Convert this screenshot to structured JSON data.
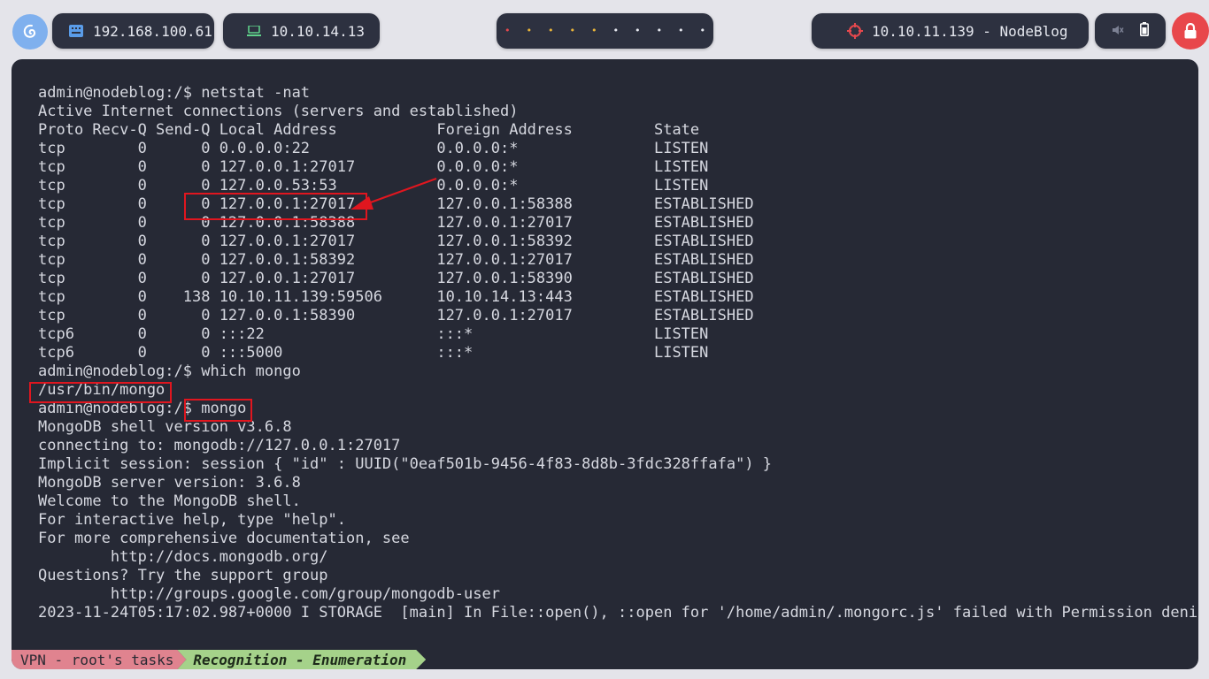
{
  "topbar": {
    "launcher_icon": "debian-swirl-icon",
    "local_ip": "192.168.100.61",
    "vpn_ip": "10.10.14.13",
    "workspaces": [
      {
        "color": "#e5484d"
      },
      {
        "color": "#e9b43a"
      },
      {
        "color": "#e9b43a"
      },
      {
        "color": "#e9b43a"
      },
      {
        "color": "#e9b43a"
      },
      {
        "color": "#e6e8ef"
      },
      {
        "color": "#e6e8ef"
      },
      {
        "color": "#e6e8ef"
      },
      {
        "color": "#e6e8ef"
      },
      {
        "color": "#e6e8ef"
      }
    ],
    "target": "10.10.11.139 - NodeBlog",
    "target_icon": "crosshair-target-icon",
    "mute_icon": "speaker-muted-icon",
    "battery_icon": "battery-icon",
    "lock_icon": "lock-icon"
  },
  "terminal": {
    "lines": [
      "admin@nodeblog:/$ netstat -nat",
      "Active Internet connections (servers and established)",
      "Proto Recv-Q Send-Q Local Address           Foreign Address         State",
      "tcp        0      0 0.0.0.0:22              0.0.0.0:*               LISTEN",
      "tcp        0      0 127.0.0.1:27017         0.0.0.0:*               LISTEN",
      "tcp        0      0 127.0.0.53:53           0.0.0.0:*               LISTEN",
      "tcp        0      0 127.0.0.1:27017         127.0.0.1:58388         ESTABLISHED",
      "tcp        0      0 127.0.0.1:58388         127.0.0.1:27017         ESTABLISHED",
      "tcp        0      0 127.0.0.1:27017         127.0.0.1:58392         ESTABLISHED",
      "tcp        0      0 127.0.0.1:58392         127.0.0.1:27017         ESTABLISHED",
      "tcp        0      0 127.0.0.1:27017         127.0.0.1:58390         ESTABLISHED",
      "tcp        0    138 10.10.11.139:59506      10.10.14.13:443         ESTABLISHED",
      "tcp        0      0 127.0.0.1:58390         127.0.0.1:27017         ESTABLISHED",
      "tcp6       0      0 :::22                   :::*                    LISTEN",
      "tcp6       0      0 :::5000                 :::*                    LISTEN",
      "admin@nodeblog:/$ which mongo",
      "/usr/bin/mongo",
      "admin@nodeblog:/$ mongo",
      "MongoDB shell version v3.6.8",
      "connecting to: mongodb://127.0.0.1:27017",
      "Implicit session: session { \"id\" : UUID(\"0eaf501b-9456-4f83-8d8b-3fdc328ffafa\") }",
      "MongoDB server version: 3.6.8",
      "Welcome to the MongoDB shell.",
      "For interactive help, type \"help\".",
      "For more comprehensive documentation, see",
      "        http://docs.mongodb.org/",
      "Questions? Try the support group",
      "        http://groups.google.com/group/mongodb-user",
      "2023-11-24T05:17:02.987+0000 I STORAGE  [main] In File::open(), ::open for '/home/admin/.mongorc.js' failed with Permission deni"
    ],
    "annotation_color": "#e0161f"
  },
  "statusbar": {
    "session": "VPN - root's tasks",
    "window": "Recognition - Enumeration"
  }
}
